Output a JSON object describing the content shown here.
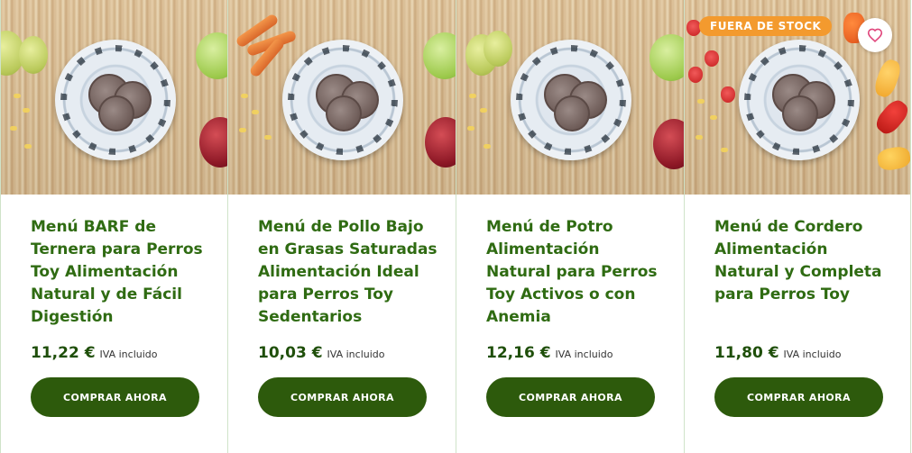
{
  "products": [
    {
      "title": "Menú BARF de Ternera para Perros Toy Alimentación Natural y de Fácil Digestión",
      "price": "11,22 €",
      "tax_note": "IVA incluido",
      "button_label": "COMPRAR AHORA"
    },
    {
      "title": "Menú de Pollo Bajo en Grasas Saturadas Alimentación Ideal para Perros Toy Sedentarios",
      "price": "10,03 €",
      "tax_note": "IVA incluido",
      "button_label": "COMPRAR AHORA"
    },
    {
      "title": "Menú de Potro Alimentación Natural para Perros Toy Activos o con Anemia",
      "price": "12,16 €",
      "tax_note": "IVA incluido",
      "button_label": "COMPRAR AHORA"
    },
    {
      "title": "Menú de Cordero Alimentación Natural y Completa para Perros Toy",
      "price": "11,80 €",
      "tax_note": "IVA incluido",
      "button_label": "COMPRAR AHORA",
      "badge": "FUERA DE STOCK",
      "favorite_icon": "heart-icon"
    }
  ],
  "colors": {
    "title": "#2f6b12",
    "price": "#1f4f0a",
    "button": "#2d5a0c",
    "badge": "#f39a2e"
  }
}
